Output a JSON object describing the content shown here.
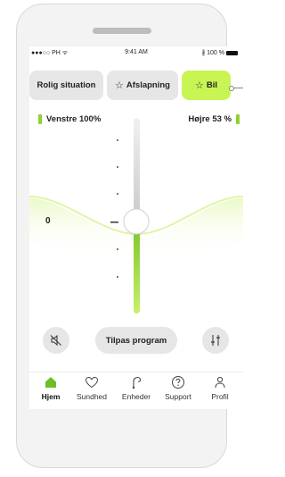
{
  "status_bar": {
    "carrier": "●●●○○ PH ᯤ",
    "time": "9:41 AM",
    "battery": "∦ 100 %"
  },
  "programs": [
    {
      "label": "Rolig situation",
      "icon": "",
      "active": false
    },
    {
      "label": "Afslapning",
      "icon": "star-outline-icon",
      "active": false
    },
    {
      "label": "Bil",
      "icon": "star-outline-icon",
      "active": true
    }
  ],
  "colors": {
    "accent_green": "#c8f553",
    "slider_green": "#8fd130",
    "button_gray": "#e6e6e6"
  },
  "volume": {
    "left_label": "Venstre 100%",
    "right_label": "Højre 53 %",
    "value_label": "0",
    "slider_level": 0.5
  },
  "controls": {
    "mute_icon": "speaker-muted-icon",
    "adjust_label": "Tilpas program",
    "equalizer_icon": "sliders-icon"
  },
  "nav": {
    "items": [
      {
        "label": "Hjem",
        "icon": "home-icon",
        "active": true
      },
      {
        "label": "Sundhed",
        "icon": "heart-icon",
        "active": false
      },
      {
        "label": "Enheder",
        "icon": "hearing-aid-icon",
        "active": false
      },
      {
        "label": "Support",
        "icon": "question-icon",
        "active": false
      },
      {
        "label": "Profil",
        "icon": "person-icon",
        "active": false
      }
    ]
  }
}
